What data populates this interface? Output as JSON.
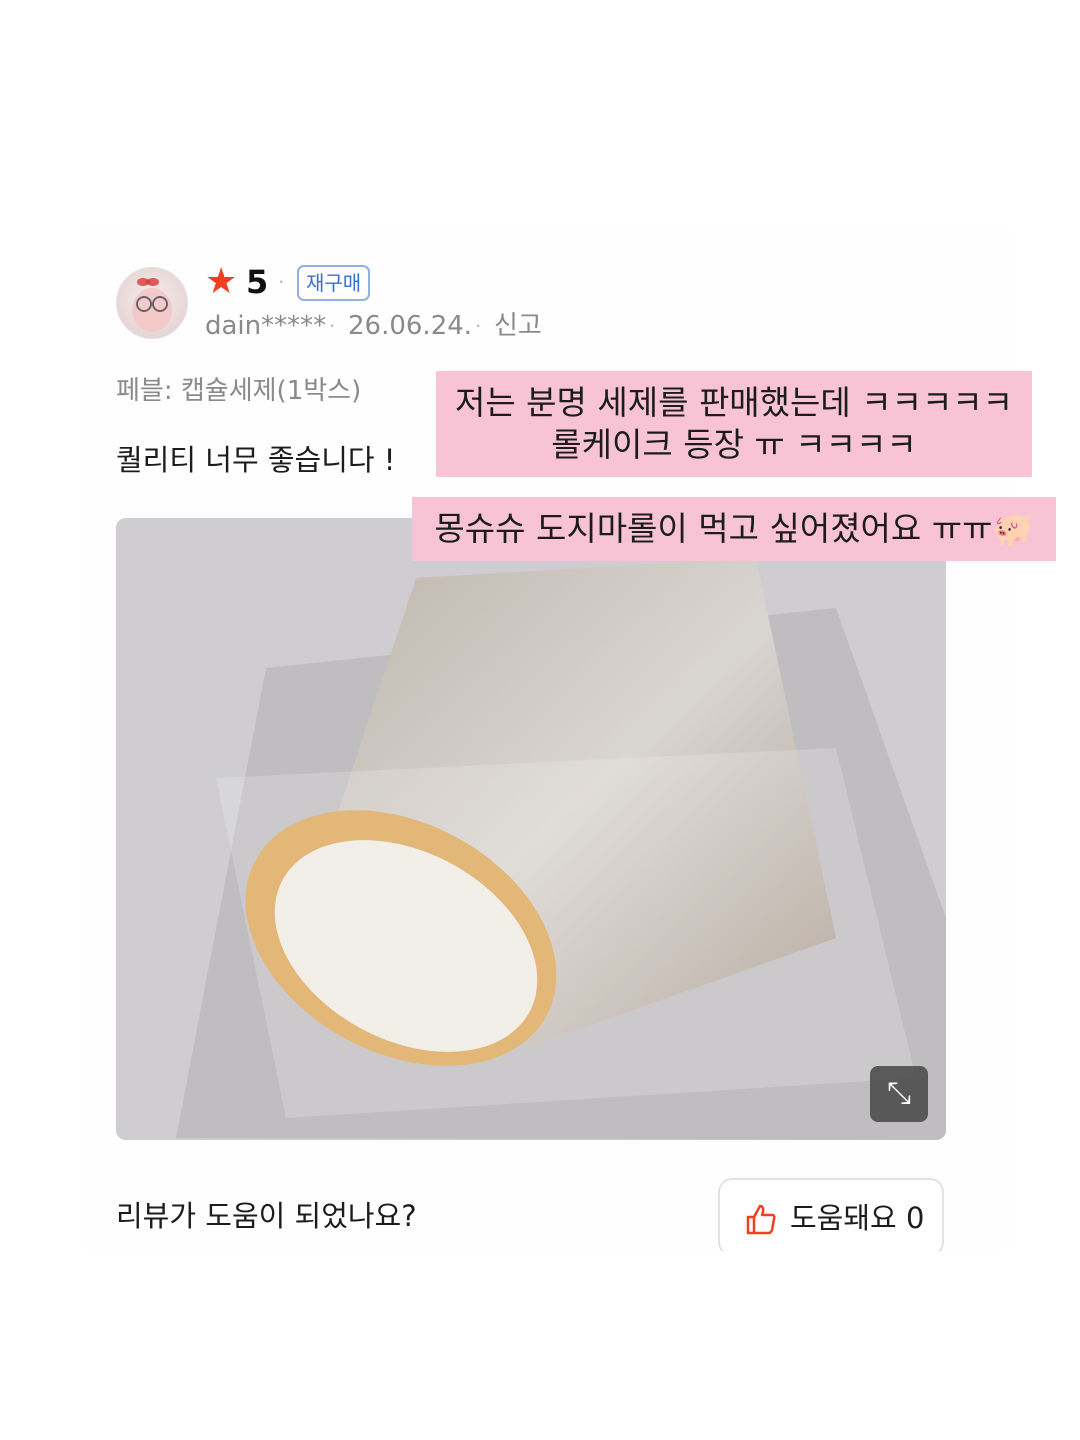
{
  "review": {
    "rating": "5",
    "repurchase_badge": "재구매",
    "username": "dain*****",
    "date": "26.06.24.",
    "report_label": "신고",
    "option": "페블: 캡슐세제(1박스)",
    "text": "퀄리티 너무 좋습니다 !"
  },
  "helpful": {
    "question": "리뷰가 도움이 되었나요?",
    "button_label": "도움돼요 0"
  },
  "captions": {
    "line1": "저는 분명 세제를 판매했는데 ㅋㅋㅋㅋㅋ",
    "line2": "롤케이크 등장 ㅠ ㅋㅋㅋㅋ",
    "line3": "몽슈슈 도지마롤이 먹고 싶어졌어요 ㅠㅠ🐖"
  },
  "icons": {
    "star": "star-icon",
    "expand": "expand-icon",
    "thumbs_up": "thumbs-up-icon"
  },
  "colors": {
    "star": "#f0401f",
    "badge": "#3a6fd0",
    "caption_bg": "#f8c3d4"
  }
}
